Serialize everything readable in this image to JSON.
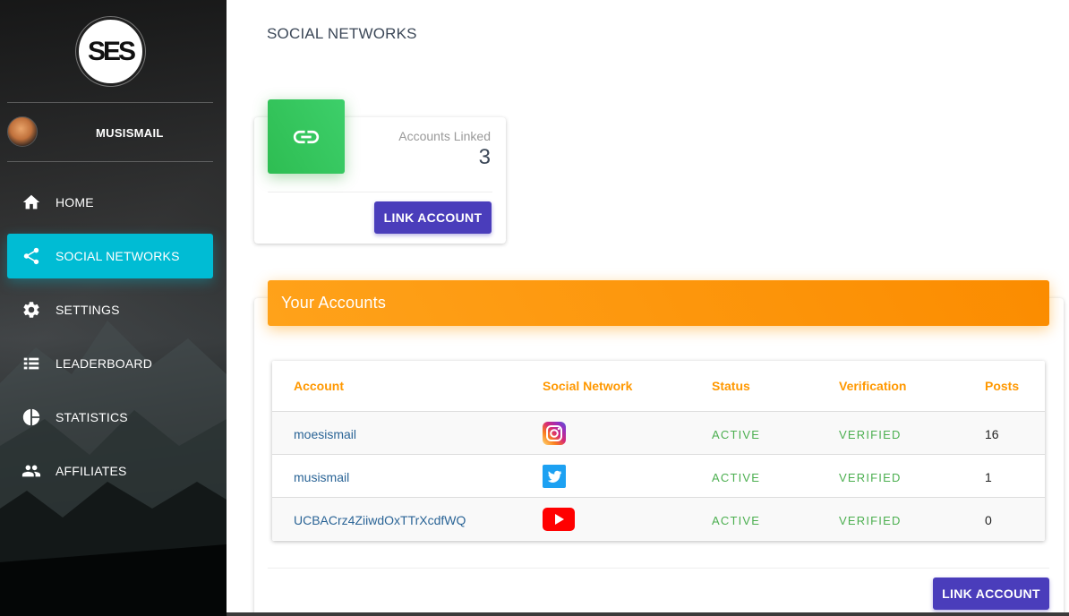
{
  "sidebar": {
    "logo_text": "SES",
    "username": "MUSISMAIL",
    "items": [
      {
        "label": "HOME",
        "icon": "home-icon",
        "active": false
      },
      {
        "label": "SOCIAL NETWORKS",
        "icon": "share-icon",
        "active": true
      },
      {
        "label": "SETTINGS",
        "icon": "gear-icon",
        "active": false
      },
      {
        "label": "LEADERBOARD",
        "icon": "list-icon",
        "active": false
      },
      {
        "label": "STATISTICS",
        "icon": "pie-chart-icon",
        "active": false
      },
      {
        "label": "AFFILIATES",
        "icon": "people-icon",
        "active": false
      }
    ],
    "active_color": "#00bcd4"
  },
  "page": {
    "title": "SOCIAL NETWORKS"
  },
  "stat_card": {
    "icon": "link-icon",
    "label": "Accounts Linked",
    "value": "3",
    "button_label": "LINK ACCOUNT",
    "icon_color": "#2ebd52"
  },
  "accounts": {
    "header": "Your Accounts",
    "header_color": "#ff9800",
    "columns": [
      "Account",
      "Social Network",
      "Status",
      "Verification",
      "Posts"
    ],
    "rows": [
      {
        "account": "moesismail",
        "network": "instagram-icon",
        "status": "ACTIVE",
        "verification": "VERIFIED",
        "posts": "16"
      },
      {
        "account": "musismail",
        "network": "twitter-icon",
        "status": "ACTIVE",
        "verification": "VERIFIED",
        "posts": "1"
      },
      {
        "account": "UCBACrz4ZiiwdOxTTrXcdfWQ",
        "network": "youtube-icon",
        "status": "ACTIVE",
        "verification": "VERIFIED",
        "posts": "0"
      }
    ],
    "button_label": "LINK ACCOUNT",
    "button_color": "#4a3dbb"
  }
}
